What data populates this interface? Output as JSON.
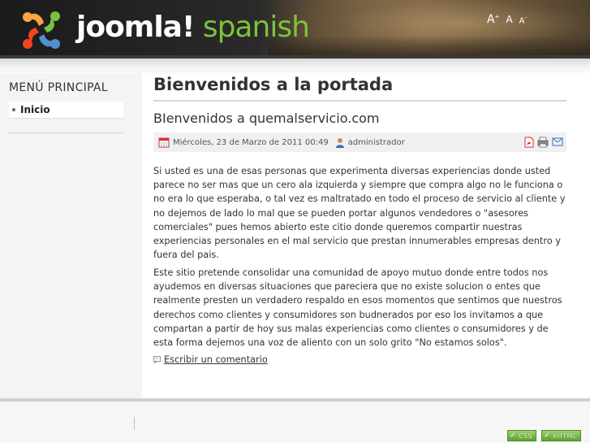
{
  "header": {
    "logo_main": "joomla!",
    "logo_sub": "spanish",
    "font_tools": {
      "increase": "A",
      "reset": "A",
      "decrease": "A",
      "increase_mark": "+",
      "decrease_mark": "-"
    }
  },
  "sidebar": {
    "title": "MENÚ PRINCIPAL",
    "items": [
      {
        "label": "Inicio"
      }
    ]
  },
  "main": {
    "page_title": "Bienvenidos a la portada",
    "article": {
      "title": "BIenvenidos a quemalservicio.com",
      "date": "Miércoles, 23 de Marzo de 2011 00:49",
      "author": "administrador",
      "paragraphs": [
        "Si usted es una de esas personas que experimenta diversas experiencias donde usted parece no ser mas que un cero ala izquierda y siempre que compra algo no le funciona o no era lo que esperaba, o tal vez es maltratado en todo el proceso de servicio al cliente y no dejemos de lado lo mal que se pueden portar algunos vendedores o \"asesores comerciales\" pues hemos abierto este citio donde queremos compartir nuestras experiencias personales en el mal servicio que prestan innumerables empresas dentro y fuera del pais.",
        "Este sitio pretende consolidar una comunidad de apoyo mutuo donde entre todos nos ayudemos en diversas situaciones que pareciera que no existe solucion o entes que realmente presten un verdadero respaldo en esos momentos que sentimos que nuestros derechos como clientes y consumidores son budnerados por eso los invitamos a que compartan a partir de hoy sus malas experiencias como clientes o consumidores y de esta forma dejemos una voz de aliento con un solo grito \"No estamos solos\"."
      ],
      "comment_link": "Escribir un comentario"
    }
  },
  "footer": {
    "badges": [
      {
        "label": "CSS"
      },
      {
        "label": "XHTML"
      }
    ]
  },
  "colors": {
    "logo_green": "#7cc43a",
    "badge_green": "#5ea132"
  }
}
